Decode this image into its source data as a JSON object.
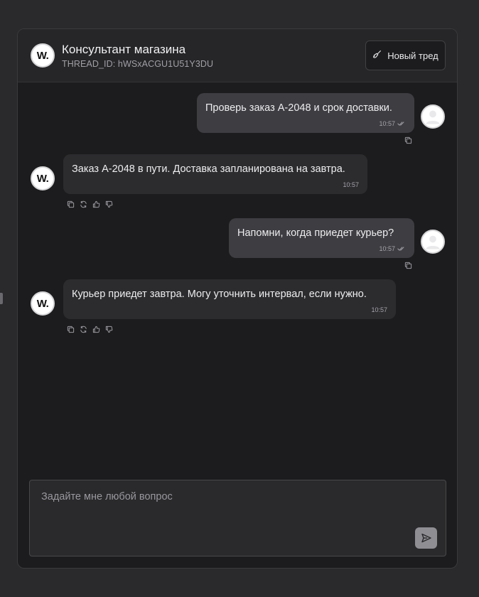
{
  "header": {
    "logo_text": "W.",
    "title": "Консультант магазина",
    "thread_id": "THREAD_ID: hWSxACGU1U51Y3DU",
    "new_thread_label": "Новый тред"
  },
  "messages": [
    {
      "role": "user",
      "text": "Проверь заказ A-2048 и срок доставки.",
      "time": "10:57"
    },
    {
      "role": "bot",
      "text": "Заказ A-2048 в пути. Доставка запланирована на завтра.",
      "time": "10:57"
    },
    {
      "role": "user",
      "text": "Напомни, когда приедет курьер?",
      "time": "10:57"
    },
    {
      "role": "bot",
      "text": "Курьер приедет завтра. Могу уточнить интервал, если нужно.",
      "time": "10:57"
    }
  ],
  "composer": {
    "placeholder": "Задайте мне любой вопрос"
  },
  "icons": {
    "new_thread": "broom-icon",
    "read_receipt": "double-check-icon",
    "copy": "copy-icon",
    "regenerate": "refresh-icon",
    "like": "thumbs-up-icon",
    "dislike": "thumbs-down-icon",
    "send": "send-icon",
    "user_avatar": "user-avatar-icon"
  },
  "colors": {
    "background": "#2a2a2c",
    "panel": "#1c1c1e",
    "user_bubble": "#3d3d42",
    "bot_bubble": "#2c2c2f"
  }
}
